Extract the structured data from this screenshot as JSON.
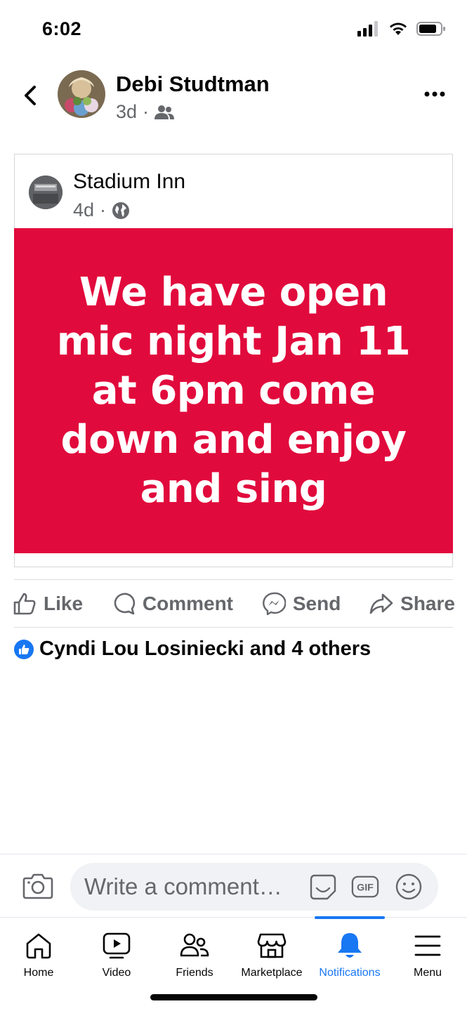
{
  "status_bar": {
    "time": "6:02"
  },
  "header": {
    "author": "Debi Studtman",
    "time_ago": "3d",
    "separator": "·"
  },
  "shared_post": {
    "page_name": "Stadium Inn",
    "time_ago": "4d",
    "separator": "·",
    "graphic_text": "We have open mic night Jan 11 at 6pm come down and enjoy and sing",
    "graphic_color": "#e10a3c"
  },
  "actions": {
    "like": "Like",
    "comment": "Comment",
    "send": "Send",
    "share": "Share"
  },
  "reactions": {
    "summary": "Cyndi Lou Losiniecki and 4 others"
  },
  "comment_bar": {
    "placeholder": "Write a comment…",
    "gif_label": "GIF"
  },
  "nav": {
    "items": [
      {
        "label": "Home",
        "icon": "home-icon"
      },
      {
        "label": "Video",
        "icon": "video-icon"
      },
      {
        "label": "Friends",
        "icon": "friends-icon"
      },
      {
        "label": "Marketplace",
        "icon": "marketplace-icon"
      },
      {
        "label": "Notifications",
        "icon": "bell-icon"
      },
      {
        "label": "Menu",
        "icon": "menu-icon"
      }
    ],
    "active_index": 4
  },
  "colors": {
    "accent": "#1877f2",
    "secondary_text": "#65676b"
  }
}
